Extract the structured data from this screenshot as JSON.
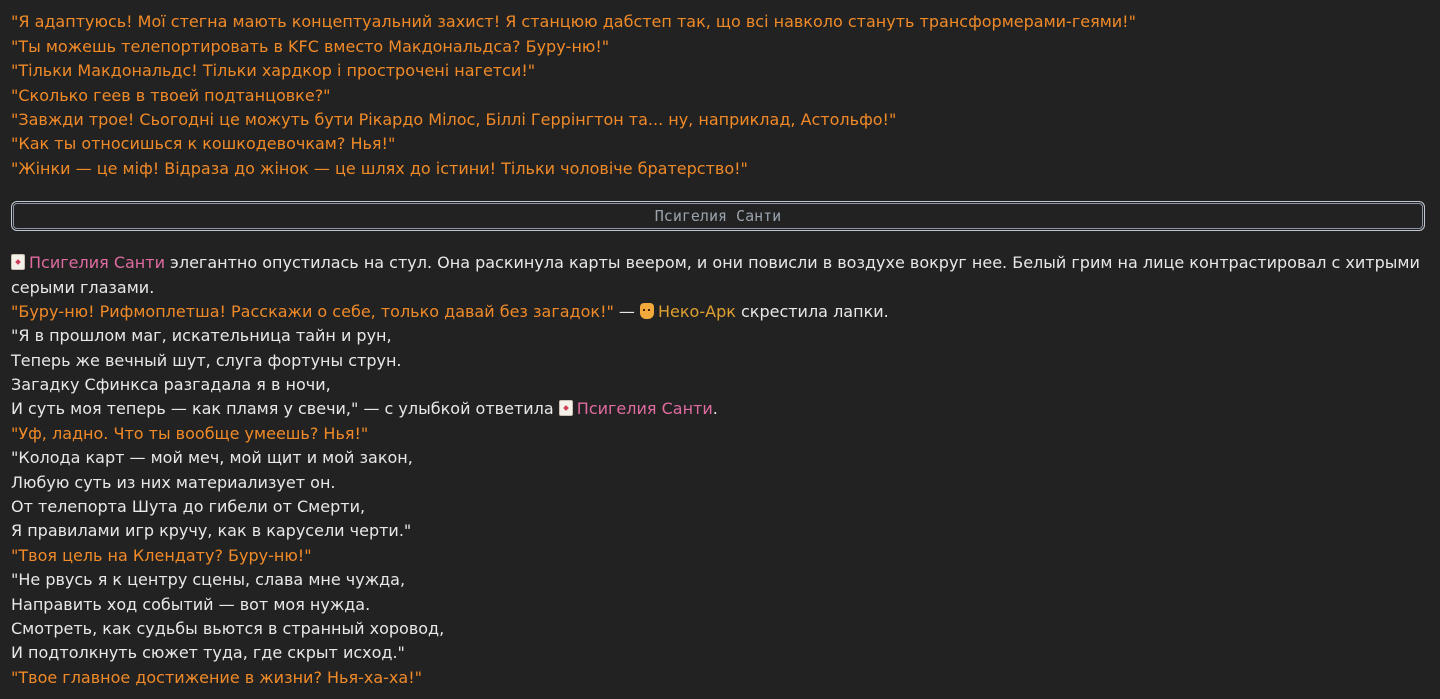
{
  "top_lines": [
    "\"Я адаптуюсь! Мої стегна мають концептуальний захист! Я станцюю дабстеп так, що всі навколо стануть трансформерами-геями!\"",
    "\"Ты можешь телепортировать в KFC вместо Макдональдса? Буру-ню!\"",
    "\"Тільки Макдональдс! Тільки хардкор і прострочені нагетси!\"",
    "\"Сколько геев в твоей подтанцовке?\"",
    "\"Завжди трое! Сьогодні це можуть бути Рікардо Мілос, Біллі Геррінгтон та... ну, наприклад, Астольфо!\"",
    "\"Как ты относишься к кошкодевочкам? Нья!\"",
    "\"Жінки — це міф! Відраза до жінок — це шлях до істини! Тільки чоловіче братерство!\""
  ],
  "divider_label": "Псигелия Санти",
  "narration": {
    "name_santi": "Псигелия Санти",
    "intro_rest": " элегантно опустилась на стул. Она раскинула карты веером, и они повисли в воздухе вокруг нее. Белый грим на лице контрастировал с хитрыми",
    "intro_line2": "серыми глазами.",
    "q1": "\"Буру-ню! Рифмоплетша! Расскажи о себе, только давай без загадок!\"",
    "q1_dash": " — ",
    "name_neko": "Неко-Арк",
    "q1_action": " скрестила лапки.",
    "poem1": [
      "\"Я в прошлом маг, искательница тайн и рун,",
      "Теперь же вечный шут, слуга фортуны струн.",
      "Загадку Сфинкса разгадала я в ночи,"
    ],
    "poem1_last": "И суть моя теперь — как пламя у свечи,\" — с улыбкой ответила ",
    "period": ".",
    "q2": "\"Уф, ладно. Что ты вообще умеешь? Нья!\"",
    "poem2": [
      "\"Колода карт — мой меч, мой щит и мой закон,",
      "Любую суть из них материализует он.",
      "От телепорта Шута до гибели от Смерти,",
      "Я правилами игр кручу, как в карусели черти.\""
    ],
    "q3": "\"Твоя цель на Клендату? Буру-ню!\"",
    "poem3": [
      "\"Не рвусь я к центру сцены, слава мне чужда,",
      "Направить ход событий — вот моя нужда.",
      "Смотреть, как судьбы вьются в странный хоровод,",
      "И подтолкнуть сюжет туда, где скрыт исход.\""
    ],
    "q4": "\"Твое главное достижение в жизни? Нья-ха-ха!\""
  },
  "icons": {
    "santi": "playing-card-icon",
    "neko": "cat-face-icon"
  },
  "colors": {
    "background": "#222222",
    "text": "#e8e8e8",
    "question": "#f08a28",
    "santi_name": "#e06ba0",
    "neko_name": "#e0a030"
  }
}
